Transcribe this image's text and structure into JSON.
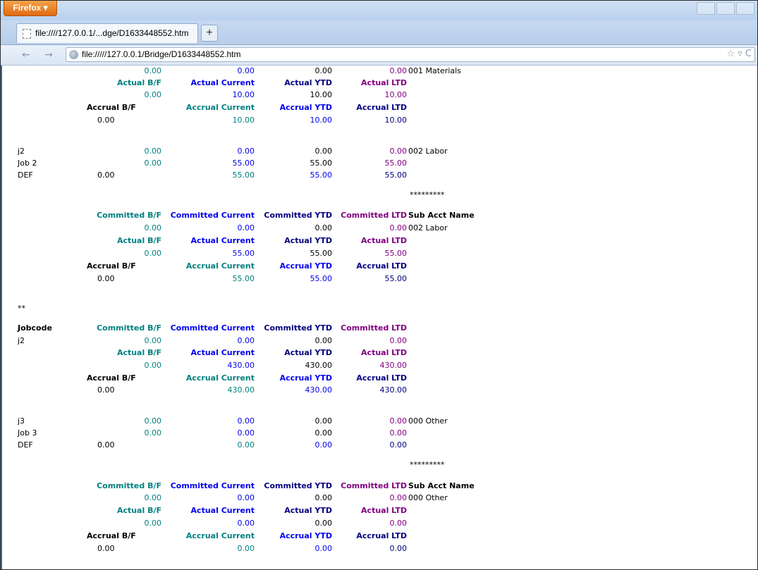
{
  "browser": {
    "app_button": "Firefox ▾",
    "tab_title": "file:////127.0.0.1/...dge/D1633448552.htm",
    "new_tab": "+",
    "url": "file://///127.0.0.1/Bridge/D1633448552.htm",
    "back": "←",
    "forward": "→",
    "url_icons": "☆ ▿ C"
  },
  "report": {
    "r1": [
      "",
      "0.00",
      "0.00",
      "0.00",
      "0.00",
      "001 Materials"
    ],
    "h_actual": [
      "",
      "Actual B/F",
      "Actual Current",
      "Actual YTD",
      "Actual LTD",
      ""
    ],
    "r2": [
      "",
      "0.00",
      "10.00",
      "10.00",
      "10.00",
      ""
    ],
    "h_accrual": [
      "",
      "Accrual B/F",
      "Accrual Current",
      "Accrual YTD",
      "Accrual LTD",
      ""
    ],
    "r3": [
      "0.00",
      "",
      "10.00",
      "10.00",
      "10.00",
      ""
    ],
    "j2_1": [
      "j2",
      "0.00",
      "0.00",
      "0.00",
      "0.00",
      "002 Labor"
    ],
    "j2_2": [
      "Job 2",
      "0.00",
      "55.00",
      "55.00",
      "55.00",
      ""
    ],
    "j2_3": [
      "DEF",
      "0.00",
      "55.00",
      "55.00",
      "55.00",
      ""
    ],
    "stars1": "*********",
    "h_committed_1": [
      "",
      "Committed B/F",
      "Committed Current",
      "Committed YTD",
      "Committed LTD",
      "Sub Acct Name"
    ],
    "s1_r1": [
      "",
      "0.00",
      "0.00",
      "0.00",
      "0.00",
      "002 Labor"
    ],
    "s1_r2": [
      "",
      "0.00",
      "55.00",
      "55.00",
      "55.00",
      ""
    ],
    "s1_r3": [
      "0.00",
      "",
      "55.00",
      "55.00",
      "55.00",
      ""
    ],
    "dbl_star": "**",
    "h_jobcode": [
      "Jobcode",
      "Committed B/F",
      "Committed Current",
      "Committed YTD",
      "Committed LTD",
      ""
    ],
    "jc_r1": [
      "j2",
      "0.00",
      "0.00",
      "0.00",
      "0.00",
      ""
    ],
    "jc_r2": [
      "",
      "0.00",
      "430.00",
      "430.00",
      "430.00",
      ""
    ],
    "jc_r3": [
      "0.00",
      "",
      "430.00",
      "430.00",
      "430.00",
      ""
    ],
    "j3_1": [
      "j3",
      "0.00",
      "0.00",
      "0.00",
      "0.00",
      "000 Other"
    ],
    "j3_2": [
      "Job 3",
      "0.00",
      "0.00",
      "0.00",
      "0.00",
      ""
    ],
    "j3_3": [
      "DEF",
      "0.00",
      "0.00",
      "0.00",
      "0.00",
      ""
    ],
    "stars2": "*********",
    "h_committed_2": [
      "",
      "Committed B/F",
      "Committed Current",
      "Committed YTD",
      "Committed LTD",
      "Sub Acct Name"
    ],
    "s2_r1": [
      "",
      "0.00",
      "0.00",
      "0.00",
      "0.00",
      "000 Other"
    ],
    "s2_r2": [
      "",
      "0.00",
      "0.00",
      "0.00",
      "0.00",
      ""
    ],
    "s2_r3": [
      "0.00",
      "",
      "0.00",
      "0.00",
      "0.00",
      ""
    ]
  }
}
